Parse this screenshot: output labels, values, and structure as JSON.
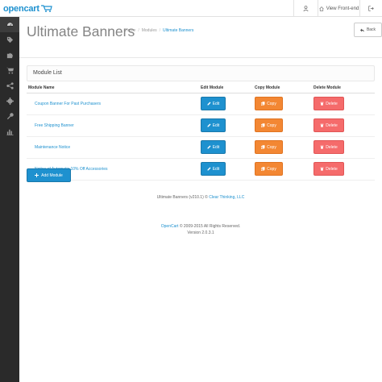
{
  "header": {
    "logo_text": "opencart",
    "view_frontend_label": "View Front-end"
  },
  "sidebar": {
    "items": [
      {
        "icon": "dashboard-icon",
        "active": true
      },
      {
        "icon": "tags-icon"
      },
      {
        "icon": "puzzle-icon"
      },
      {
        "icon": "shopping-cart-icon"
      },
      {
        "icon": "share-icon"
      },
      {
        "icon": "cog-icon"
      },
      {
        "icon": "wrench-icon"
      },
      {
        "icon": "bar-chart-icon"
      }
    ]
  },
  "page": {
    "title": "Ultimate Banners",
    "breadcrumb": [
      "Home",
      "Modules",
      "Ultimate Banners"
    ],
    "back_label": "Back"
  },
  "panel": {
    "title": "Module List",
    "columns": [
      "Module Name",
      "Edit Module",
      "Copy Module",
      "Delete Module"
    ],
    "rows": [
      {
        "name": "Coupon Banner For Past Purchasers"
      },
      {
        "name": "Free Shipping Banner"
      },
      {
        "name": "Maintenance Notice"
      },
      {
        "name": "Notice of Automatic 10% Off Accessories"
      }
    ],
    "edit_label": "Edit",
    "copy_label": "Copy",
    "delete_label": "Delete",
    "add_label": "Add Module"
  },
  "footnote": {
    "text": "Ultimate Banners (v210.1) © ",
    "link": "Clear Thinking, LLC"
  },
  "footer": {
    "link": "OpenCart",
    "text": " © 2009-2015 All Rights Reserved.",
    "version": "Version 2.0.3.1"
  },
  "colors": {
    "primary": "#1e91cf",
    "copy": "#f38733",
    "delete": "#f56b6b",
    "sidebar": "#2a2a2a"
  }
}
